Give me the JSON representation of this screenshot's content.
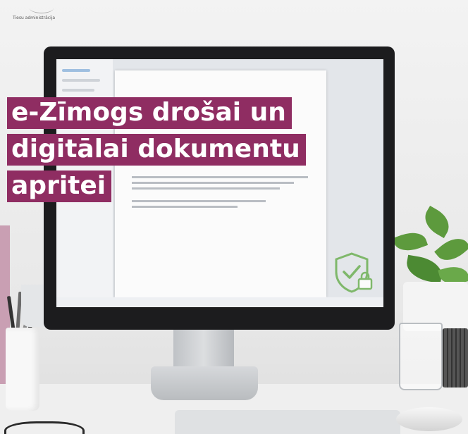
{
  "org": {
    "label": "Tiesu administrācija"
  },
  "headline": {
    "lines": [
      "e-Zīmogs drošai un",
      "digitālai dokumentu",
      "apritei"
    ]
  },
  "colors": {
    "headline_bg": "#8f2d62",
    "headline_text": "#ffffff",
    "shield_icon": "#7fb86b"
  },
  "icons": [
    "shield-check-lock-icon"
  ]
}
